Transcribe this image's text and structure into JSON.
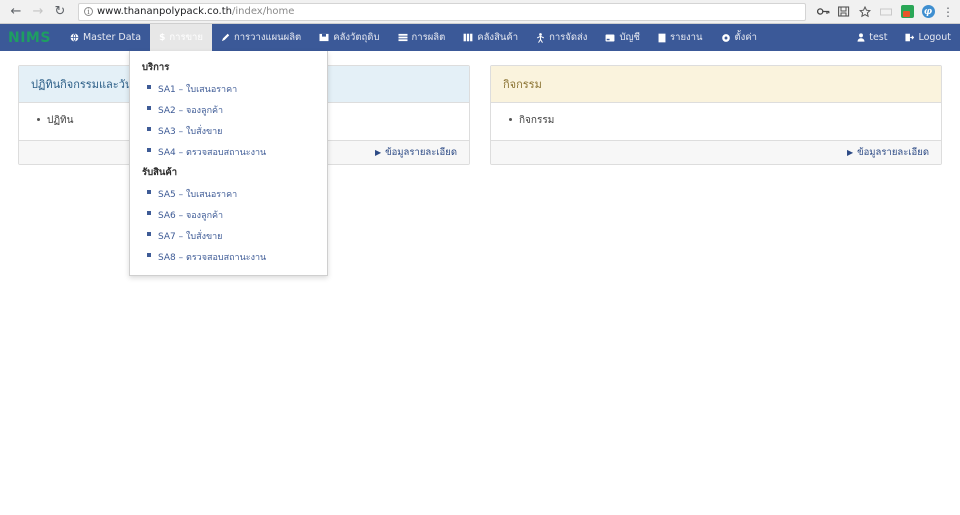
{
  "browser": {
    "back_icon": "back-arrow",
    "forward_icon": "forward-arrow",
    "reload_icon": "reload",
    "url_host": "www.thananpolypack.co.th",
    "url_path": "/index/home",
    "info_glyph": "i",
    "key_icon": "key",
    "save_icon": "save-page",
    "star_icon": "bookmark-star",
    "ext_blue_glyph": "φ",
    "menu_icon": "kebab-menu"
  },
  "navbar": {
    "brand": "NIMS",
    "items": [
      {
        "label": "Master Data",
        "icon": "globe"
      },
      {
        "label": "การขาย",
        "icon": "dollar"
      },
      {
        "label": "การวางแผนผลิต",
        "icon": "pencil"
      },
      {
        "label": "คลังวัตถุดิบ",
        "icon": "box"
      },
      {
        "label": "การผลิต",
        "icon": "layers"
      },
      {
        "label": "คลังสินค้า",
        "icon": "warehouse"
      },
      {
        "label": "การจัดส่ง",
        "icon": "truck"
      },
      {
        "label": "บัญชี",
        "icon": "wallet"
      },
      {
        "label": "รายงาน",
        "icon": "report"
      },
      {
        "label": "ตั้งค่า",
        "icon": "gear"
      }
    ],
    "active_index": 1,
    "user_label": "test",
    "user_icon": "user",
    "logout_label": "Logout",
    "logout_icon": "logout"
  },
  "dropdown": {
    "groups": [
      {
        "header": "บริการ",
        "items": [
          "SA1 – ใบเสนอราคา",
          "SA2 – จองลูกค้า",
          "SA3 – ใบสั่งขาย",
          "SA4 – ตรวจสอบสถานะงาน"
        ]
      },
      {
        "header": "รับสินค้า",
        "items": [
          "SA5 – ใบเสนอราคา",
          "SA6 – จองลูกค้า",
          "SA7 – ใบสั่งขาย",
          "SA8 – ตรวจสอบสถานะงาน"
        ]
      }
    ]
  },
  "panels": {
    "left": {
      "title": "ปฏิทินกิจกรรมและวันหยุด",
      "items": [
        "ปฏิทิน"
      ],
      "detail_label": "ข้อมูลรายละเอียด"
    },
    "right": {
      "title": "กิจกรรม",
      "items": [
        "กิจกรรม"
      ],
      "detail_label": "ข้อมูลรายละเอียด"
    }
  },
  "colors": {
    "navbar_bg": "#3b5998",
    "brand_green": "#1e9e62",
    "panel_blue": "#e4f0f7",
    "panel_cream": "#faf3dd",
    "link_blue": "#2c4a85"
  }
}
